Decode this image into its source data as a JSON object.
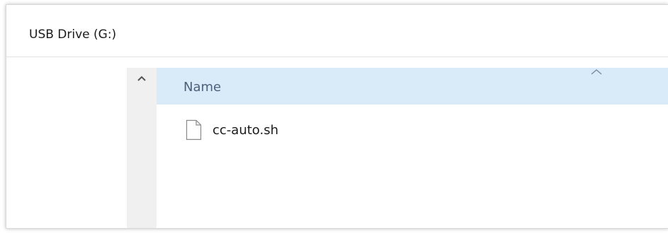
{
  "window": {
    "title": "USB Drive (G:)"
  },
  "columns": {
    "name_header": "Name"
  },
  "files": [
    {
      "name": "cc-auto.sh",
      "icon": "document-icon"
    }
  ],
  "icons": {
    "scroll_up": "chevron-up-icon",
    "sort": "sort-ascending-icon"
  },
  "colors": {
    "header_background": "#d9ebf9",
    "scroll_track": "#f0f0f0",
    "header_text": "#4c607a"
  }
}
